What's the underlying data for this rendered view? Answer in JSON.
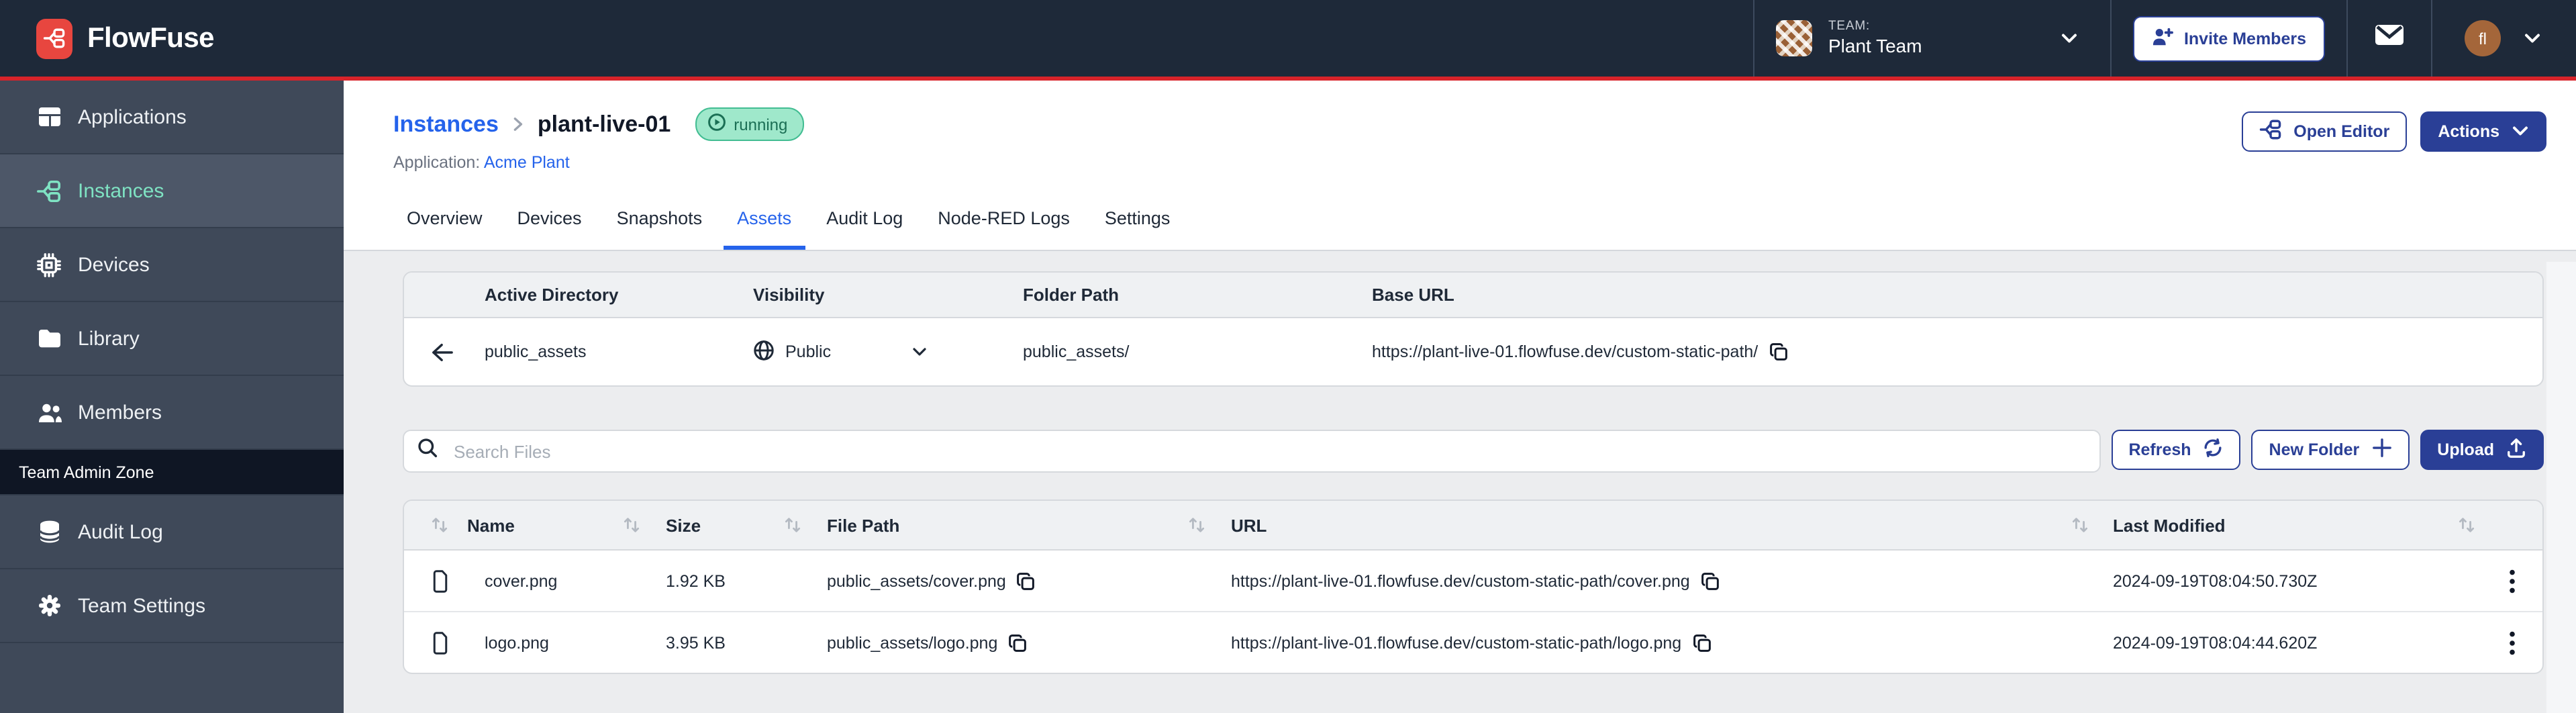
{
  "header": {
    "brand": "FlowFuse",
    "team_label": "TEAM:",
    "team_name": "Plant Team",
    "invite_button": "Invite Members",
    "avatar_initials": "fl"
  },
  "sidebar": {
    "items": [
      {
        "label": "Applications",
        "icon": "applications-grid-icon"
      },
      {
        "label": "Instances",
        "icon": "instances-fork-icon",
        "active": true
      },
      {
        "label": "Devices",
        "icon": "chip-icon"
      },
      {
        "label": "Library",
        "icon": "folder-icon"
      },
      {
        "label": "Members",
        "icon": "users-icon"
      }
    ],
    "admin_zone_label": "Team Admin Zone",
    "admin_items": [
      {
        "label": "Audit Log",
        "icon": "database-icon"
      },
      {
        "label": "Team Settings",
        "icon": "gear-icon"
      }
    ]
  },
  "page": {
    "breadcrumb_parent": "Instances",
    "breadcrumb_current": "plant-live-01",
    "status_badge": "running",
    "application_label": "Application:",
    "application_name": "Acme Plant",
    "open_editor_button": "Open Editor",
    "actions_button": "Actions",
    "tabs": [
      "Overview",
      "Devices",
      "Snapshots",
      "Assets",
      "Audit Log",
      "Node-RED Logs",
      "Settings"
    ],
    "active_tab": "Assets"
  },
  "directory": {
    "columns": [
      "Active Directory",
      "Visibility",
      "Folder Path",
      "Base URL"
    ],
    "name": "public_assets",
    "visibility": "Public",
    "folder_path": "public_assets/",
    "base_url": "https://plant-live-01.flowfuse.dev/custom-static-path/"
  },
  "toolbar": {
    "search_placeholder": "Search Files",
    "refresh_button": "Refresh",
    "new_folder_button": "New Folder",
    "upload_button": "Upload"
  },
  "files": {
    "columns": [
      "Name",
      "Size",
      "File Path",
      "URL",
      "Last Modified"
    ],
    "rows": [
      {
        "name": "cover.png",
        "size": "1.92 KB",
        "path": "public_assets/cover.png",
        "url": "https://plant-live-01.flowfuse.dev/custom-static-path/cover.png",
        "modified": "2024-09-19T08:04:50.730Z"
      },
      {
        "name": "logo.png",
        "size": "3.95 KB",
        "path": "public_assets/logo.png",
        "url": "https://plant-live-01.flowfuse.dev/custom-static-path/logo.png",
        "modified": "2024-09-19T08:04:44.620Z"
      }
    ]
  },
  "colors": {
    "topbar_bg": "#1e2939",
    "accent_red": "#d8232a",
    "logo_red": "#e8463f",
    "sidebar_bg": "#3f4959",
    "sidebar_active_bg": "#4d5768",
    "teal_accent": "#7fe3c3",
    "navy_button": "#2a3f96",
    "link_blue": "#2563eb",
    "badge_green_bg": "#9fe8cb",
    "badge_green_text": "#1b6f55",
    "page_bg": "#ecedef"
  },
  "icons": {
    "brand": "fork-nodes",
    "search": "magnifier",
    "visibility": "globe",
    "copy": "two-stacked-squares",
    "row_menu": "kebab-dots",
    "sort": "up-down-arrows",
    "upload": "arrow-up-tray",
    "refresh": "circular-arrows"
  }
}
